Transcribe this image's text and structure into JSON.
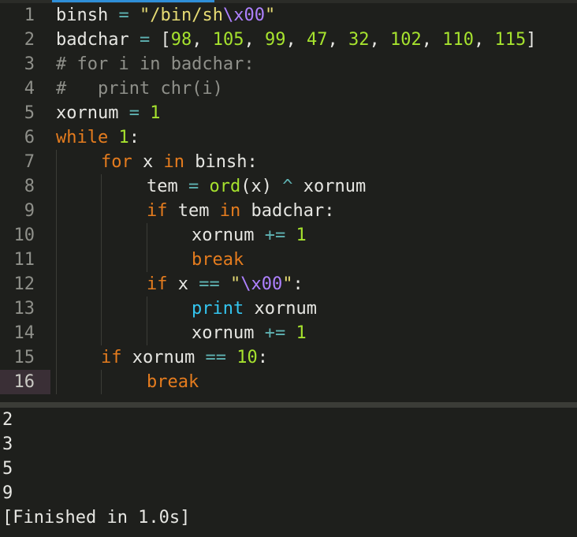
{
  "editor": {
    "current_line": "16",
    "lines": [
      {
        "num": "1",
        "tokens": {
          "a": "binsh",
          "b": " = ",
          "c": "\"/bin/sh",
          "d": "\\x00",
          "e": "\""
        }
      },
      {
        "num": "2",
        "tokens": {
          "a": "badchar",
          "b": " = ",
          "c": "[",
          "d": "98",
          "e": ", ",
          "f": "105",
          "g": ", ",
          "h": "99",
          "i": ", ",
          "j": "47",
          "k": ", ",
          "l": "32",
          "m": ", ",
          "n": "102",
          "o": ", ",
          "p": "110",
          "q": ", ",
          "r": "115",
          "s": "]"
        }
      },
      {
        "num": "3",
        "tokens": {
          "a": "# for i in badchar:"
        }
      },
      {
        "num": "4",
        "tokens": {
          "a": "#   print chr(i)"
        }
      },
      {
        "num": "5",
        "tokens": {
          "a": "xornum",
          "b": " = ",
          "c": "1"
        }
      },
      {
        "num": "6",
        "tokens": {
          "a": "while",
          "b": " ",
          "c": "1",
          "d": ":"
        }
      },
      {
        "num": "7",
        "tokens": {
          "a": "for",
          "b": " x ",
          "c": "in",
          "d": " binsh:"
        }
      },
      {
        "num": "8",
        "tokens": {
          "a": "tem ",
          "b": "=",
          "c": " ",
          "d": "ord",
          "e": "(x) ",
          "f": "^",
          "g": " xornum"
        }
      },
      {
        "num": "9",
        "tokens": {
          "a": "if",
          "b": " tem ",
          "c": "in",
          "d": " badchar:"
        }
      },
      {
        "num": "10",
        "tokens": {
          "a": "xornum ",
          "b": "+=",
          "c": " ",
          "d": "1"
        }
      },
      {
        "num": "11",
        "tokens": {
          "a": "break"
        }
      },
      {
        "num": "12",
        "tokens": {
          "a": "if",
          "b": " x ",
          "c": "==",
          "d": " ",
          "e": "\"",
          "f": "\\x00",
          "g": "\"",
          "h": ":"
        }
      },
      {
        "num": "13",
        "tokens": {
          "a": "print",
          "b": " xornum"
        }
      },
      {
        "num": "14",
        "tokens": {
          "a": "xornum ",
          "b": "+=",
          "c": " ",
          "d": "1"
        }
      },
      {
        "num": "15",
        "tokens": {
          "a": "if",
          "b": " xornum ",
          "c": "==",
          "d": " ",
          "e": "10",
          "f": ":"
        }
      },
      {
        "num": "16",
        "tokens": {
          "a": "break"
        }
      }
    ]
  },
  "output": {
    "lines": [
      "2",
      "3",
      "5",
      "9",
      "[Finished in 1.0s]"
    ]
  },
  "colors": {
    "background": "#1e1f1c",
    "keyword": "#e57c1e",
    "string": "#e6db74",
    "escape": "#ae81ff",
    "number": "#a6e22e",
    "operator": "#5fb3b3",
    "comment": "#8f908a",
    "builtin": "#34c6f0",
    "tab_indicator": "#2f8fd8",
    "current_line_gutter": "#3a2f36"
  }
}
